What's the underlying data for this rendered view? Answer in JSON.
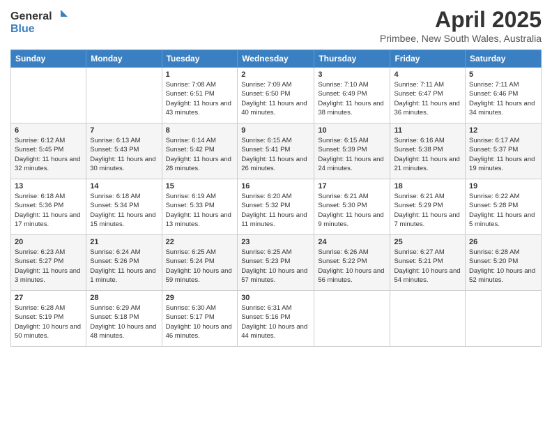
{
  "header": {
    "logo_general": "General",
    "logo_blue": "Blue",
    "main_title": "April 2025",
    "subtitle": "Primbee, New South Wales, Australia"
  },
  "calendar": {
    "days_of_week": [
      "Sunday",
      "Monday",
      "Tuesday",
      "Wednesday",
      "Thursday",
      "Friday",
      "Saturday"
    ],
    "weeks": [
      [
        {
          "day": "",
          "info": ""
        },
        {
          "day": "",
          "info": ""
        },
        {
          "day": "1",
          "info": "Sunrise: 7:08 AM\nSunset: 6:51 PM\nDaylight: 11 hours and 43 minutes."
        },
        {
          "day": "2",
          "info": "Sunrise: 7:09 AM\nSunset: 6:50 PM\nDaylight: 11 hours and 40 minutes."
        },
        {
          "day": "3",
          "info": "Sunrise: 7:10 AM\nSunset: 6:49 PM\nDaylight: 11 hours and 38 minutes."
        },
        {
          "day": "4",
          "info": "Sunrise: 7:11 AM\nSunset: 6:47 PM\nDaylight: 11 hours and 36 minutes."
        },
        {
          "day": "5",
          "info": "Sunrise: 7:11 AM\nSunset: 6:46 PM\nDaylight: 11 hours and 34 minutes."
        }
      ],
      [
        {
          "day": "6",
          "info": "Sunrise: 6:12 AM\nSunset: 5:45 PM\nDaylight: 11 hours and 32 minutes."
        },
        {
          "day": "7",
          "info": "Sunrise: 6:13 AM\nSunset: 5:43 PM\nDaylight: 11 hours and 30 minutes."
        },
        {
          "day": "8",
          "info": "Sunrise: 6:14 AM\nSunset: 5:42 PM\nDaylight: 11 hours and 28 minutes."
        },
        {
          "day": "9",
          "info": "Sunrise: 6:15 AM\nSunset: 5:41 PM\nDaylight: 11 hours and 26 minutes."
        },
        {
          "day": "10",
          "info": "Sunrise: 6:15 AM\nSunset: 5:39 PM\nDaylight: 11 hours and 24 minutes."
        },
        {
          "day": "11",
          "info": "Sunrise: 6:16 AM\nSunset: 5:38 PM\nDaylight: 11 hours and 21 minutes."
        },
        {
          "day": "12",
          "info": "Sunrise: 6:17 AM\nSunset: 5:37 PM\nDaylight: 11 hours and 19 minutes."
        }
      ],
      [
        {
          "day": "13",
          "info": "Sunrise: 6:18 AM\nSunset: 5:36 PM\nDaylight: 11 hours and 17 minutes."
        },
        {
          "day": "14",
          "info": "Sunrise: 6:18 AM\nSunset: 5:34 PM\nDaylight: 11 hours and 15 minutes."
        },
        {
          "day": "15",
          "info": "Sunrise: 6:19 AM\nSunset: 5:33 PM\nDaylight: 11 hours and 13 minutes."
        },
        {
          "day": "16",
          "info": "Sunrise: 6:20 AM\nSunset: 5:32 PM\nDaylight: 11 hours and 11 minutes."
        },
        {
          "day": "17",
          "info": "Sunrise: 6:21 AM\nSunset: 5:30 PM\nDaylight: 11 hours and 9 minutes."
        },
        {
          "day": "18",
          "info": "Sunrise: 6:21 AM\nSunset: 5:29 PM\nDaylight: 11 hours and 7 minutes."
        },
        {
          "day": "19",
          "info": "Sunrise: 6:22 AM\nSunset: 5:28 PM\nDaylight: 11 hours and 5 minutes."
        }
      ],
      [
        {
          "day": "20",
          "info": "Sunrise: 6:23 AM\nSunset: 5:27 PM\nDaylight: 11 hours and 3 minutes."
        },
        {
          "day": "21",
          "info": "Sunrise: 6:24 AM\nSunset: 5:26 PM\nDaylight: 11 hours and 1 minute."
        },
        {
          "day": "22",
          "info": "Sunrise: 6:25 AM\nSunset: 5:24 PM\nDaylight: 10 hours and 59 minutes."
        },
        {
          "day": "23",
          "info": "Sunrise: 6:25 AM\nSunset: 5:23 PM\nDaylight: 10 hours and 57 minutes."
        },
        {
          "day": "24",
          "info": "Sunrise: 6:26 AM\nSunset: 5:22 PM\nDaylight: 10 hours and 56 minutes."
        },
        {
          "day": "25",
          "info": "Sunrise: 6:27 AM\nSunset: 5:21 PM\nDaylight: 10 hours and 54 minutes."
        },
        {
          "day": "26",
          "info": "Sunrise: 6:28 AM\nSunset: 5:20 PM\nDaylight: 10 hours and 52 minutes."
        }
      ],
      [
        {
          "day": "27",
          "info": "Sunrise: 6:28 AM\nSunset: 5:19 PM\nDaylight: 10 hours and 50 minutes."
        },
        {
          "day": "28",
          "info": "Sunrise: 6:29 AM\nSunset: 5:18 PM\nDaylight: 10 hours and 48 minutes."
        },
        {
          "day": "29",
          "info": "Sunrise: 6:30 AM\nSunset: 5:17 PM\nDaylight: 10 hours and 46 minutes."
        },
        {
          "day": "30",
          "info": "Sunrise: 6:31 AM\nSunset: 5:16 PM\nDaylight: 10 hours and 44 minutes."
        },
        {
          "day": "",
          "info": ""
        },
        {
          "day": "",
          "info": ""
        },
        {
          "day": "",
          "info": ""
        }
      ]
    ]
  }
}
